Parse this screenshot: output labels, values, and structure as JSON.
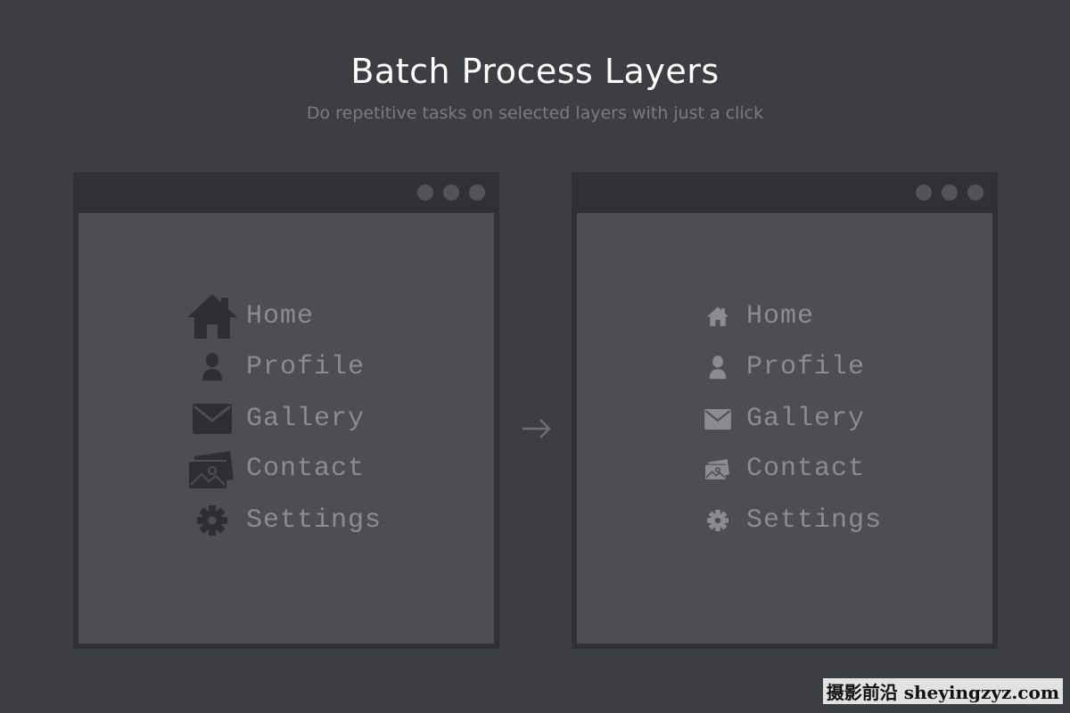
{
  "header": {
    "title": "Batch Process Layers",
    "subtitle": "Do repetitive tasks on selected layers with just a click"
  },
  "menu_items": [
    {
      "label": "Home",
      "icon": "home-icon"
    },
    {
      "label": "Profile",
      "icon": "user-icon"
    },
    {
      "label": "Gallery",
      "icon": "envelope-icon"
    },
    {
      "label": "Contact",
      "icon": "photos-icon"
    },
    {
      "label": "Settings",
      "icon": "gear-icon"
    }
  ],
  "colors": {
    "background": "#3d3e42",
    "window_frame": "#313135",
    "window_content": "#4e4e52",
    "left_icon": "#2f2f33",
    "right_icon": "#8c8c90",
    "label": "#8c8c90"
  },
  "watermark": "摄影前沿 sheyingzyz.com"
}
